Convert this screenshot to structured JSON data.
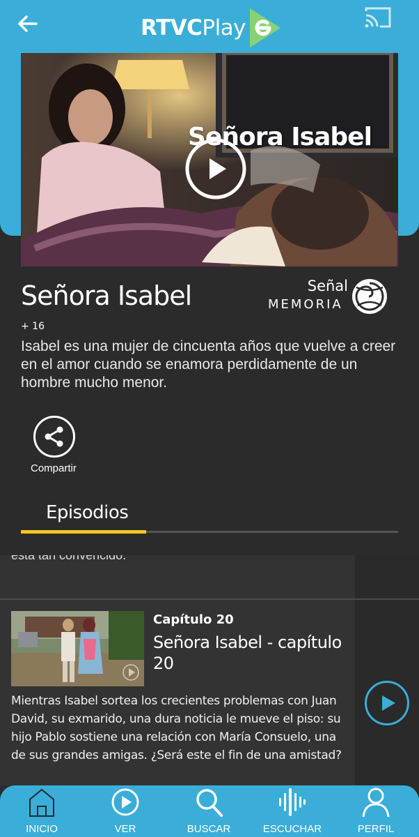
{
  "header": {
    "logo_text_bold": "RTVC",
    "logo_text_light": "Play",
    "back_icon": "arrow-left-icon",
    "cast_icon": "cast-icon",
    "accent_color": "#3aaed8"
  },
  "hero": {
    "overlay_title": "Señora Isabel",
    "play_icon": "play-circle-icon"
  },
  "show": {
    "title": "Señora Isabel",
    "channel_top": "Señal",
    "channel_bottom": "MEMORIA",
    "rating": "+ 16",
    "description": "Isabel es una mujer de cincuenta años que vuelve a creer en el amor cuando se enamora perdidamente de un hombre mucho menor."
  },
  "actions": {
    "share_label": "Compartir",
    "share_icon": "share-icon"
  },
  "tabs": [
    {
      "label": "Episodios",
      "active": true,
      "indicator_color": "#f3c623"
    }
  ],
  "episodes": {
    "cut_text": "esta tan convencido.",
    "items": [
      {
        "label": "Capítulo 20",
        "title": "Señora Isabel - capítulo 20",
        "description": "Mientras Isabel sortea los crecientes problemas con Juan David, su exmarido, una dura noticia le mueve el piso: su hijo Pablo sostiene una relación con María Consuelo, una de sus grandes amigas. ¿Será este el fin de una amistad?"
      }
    ]
  },
  "bottom_nav": [
    {
      "label": "INICIO",
      "icon": "home-icon"
    },
    {
      "label": "VER",
      "icon": "play-circle-icon"
    },
    {
      "label": "BUSCAR",
      "icon": "search-icon"
    },
    {
      "label": "ESCUCHAR",
      "icon": "audio-wave-icon"
    },
    {
      "label": "PERFIL",
      "icon": "user-icon"
    }
  ]
}
